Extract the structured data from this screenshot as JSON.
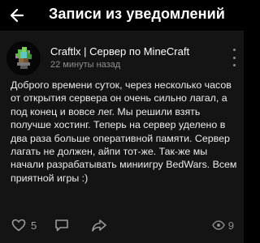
{
  "header": {
    "title": "Записи из уведомлений",
    "back_icon": "arrow-left-icon"
  },
  "post": {
    "author": "Craftlx | Сервер по MineCraft",
    "time": "22 минуты назад",
    "text": "Доброго времени суток, через несколько часов от открытия сервера он очень сильно лагал, а под конец и вовсе лег. Мы решили взять получше хостинг. Теперь на сервер уделено в два раза больше оперативной памяти. Сервер лагать не должен, айпи тот-же. Так-же мы начали разрабатывать миниигру BedWars. Всем приятной игры :)",
    "likes": "5",
    "views": "9"
  },
  "colors": {
    "background": "#000000",
    "card": "#141414",
    "text": "#ececec",
    "muted": "#8f8f8f"
  },
  "icons": {
    "more": "more-vertical-icon",
    "like": "heart-icon",
    "comment": "comment-icon",
    "share": "share-icon",
    "views": "eye-icon"
  }
}
